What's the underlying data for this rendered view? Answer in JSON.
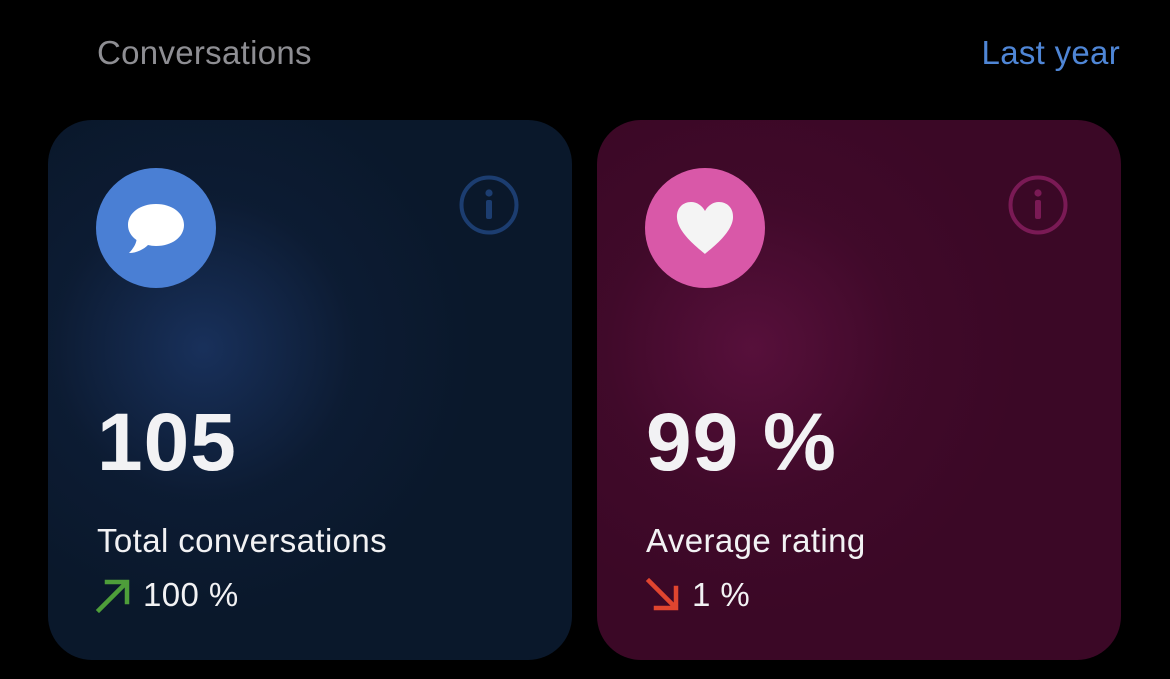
{
  "header": {
    "title": "Conversations",
    "period": "Last year"
  },
  "cards": [
    {
      "value": "105",
      "label": "Total conversations",
      "trend": "100 %",
      "trend_direction": "up",
      "icon": "speech-bubble-icon",
      "accent": "#4a7fd4",
      "trend_color": "#4e9e3a",
      "info_icon": "info-icon"
    },
    {
      "value": "99 %",
      "label": "Average rating",
      "trend": "1 %",
      "trend_direction": "down",
      "icon": "heart-icon",
      "accent": "#d958a8",
      "trend_color": "#e0452f",
      "info_icon": "info-icon"
    }
  ]
}
